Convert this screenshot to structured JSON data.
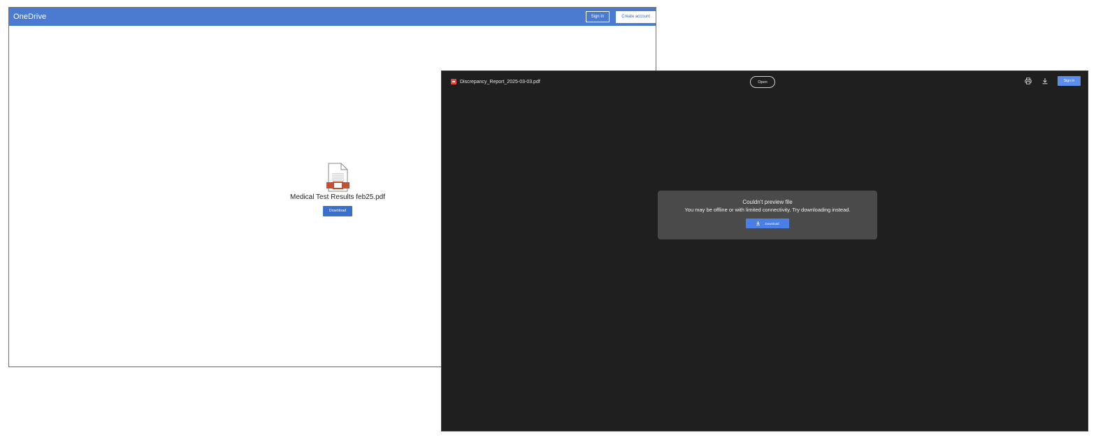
{
  "onedrive": {
    "brand": "OneDrive",
    "sign_in": "Sign In",
    "create_account": "Create account",
    "file_name": "Medical Test Results feb25.pdf",
    "download": "Download",
    "colors": {
      "header": "#4a7bd0",
      "button": "#3a6fd0",
      "file_accent": "#c8502e"
    },
    "icons": {
      "file": "document-icon"
    }
  },
  "viewer": {
    "file_name": "Discrepancy_Report_2025-03-03.pdf",
    "open": "Open",
    "sign_in": "Sign in",
    "dialog": {
      "title": "Couldn't preview file",
      "message": "You may be offline or with limited connectivity. Try downloading instead.",
      "download": "Download"
    },
    "colors": {
      "background": "#1f1f1f",
      "dialog": "#4a4a4a",
      "accent": "#4a7fe8",
      "pdf_badge": "#e8473b"
    },
    "icons": {
      "file_type": "pdf-icon",
      "print": "print-icon",
      "download": "download-icon",
      "dialog_download": "download-icon"
    }
  }
}
